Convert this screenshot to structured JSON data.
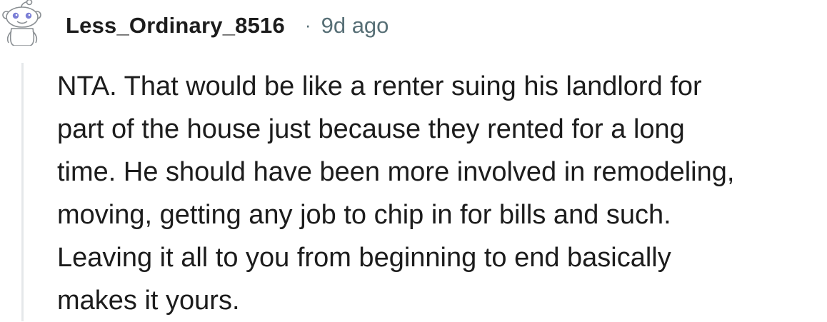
{
  "comment": {
    "author": "Less_Ordinary_8516",
    "separator": "·",
    "age": "9d ago",
    "body_lines": [
      "NTA. That would be like a renter suing his landlord for",
      "part of the house just because they rented for a long",
      "time. He should have been more involved in remodeling,",
      "moving, getting any job to chip in for bills and such.",
      "Leaving it all to you from beginning to end basically",
      "makes it yours."
    ],
    "avatar_icon": "snoo-avatar-icon"
  },
  "colors": {
    "text": "#1c1c1c",
    "meta": "#576f76",
    "thread_line": "#e5e8ea",
    "avatar_outline": "#8a8f93",
    "avatar_eyes": "#7b7fd6"
  }
}
